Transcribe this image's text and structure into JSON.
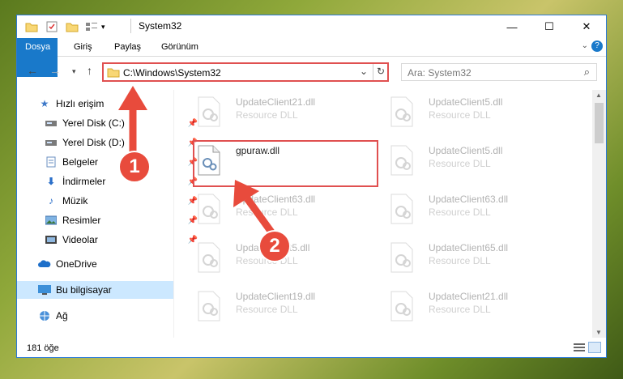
{
  "window": {
    "title": "System32"
  },
  "ribbon": {
    "tabs": [
      "Dosya",
      "Giriş",
      "Paylaş",
      "Görünüm"
    ]
  },
  "address": {
    "path": "C:\\Windows\\System32"
  },
  "search": {
    "placeholder": "Ara: System32"
  },
  "nav": {
    "items": [
      {
        "label": "Hızlı erişim",
        "icon": "star-icon"
      },
      {
        "label": "Yerel Disk (C:)",
        "icon": "drive-icon",
        "pinned": true
      },
      {
        "label": "Yerel Disk (D:)",
        "icon": "drive-icon",
        "pinned": true
      },
      {
        "label": "Belgeler",
        "icon": "documents-icon",
        "pinned": true
      },
      {
        "label": "İndirmeler",
        "icon": "download-icon",
        "pinned": true
      },
      {
        "label": "Müzik",
        "icon": "music-icon",
        "pinned": true
      },
      {
        "label": "Resimler",
        "icon": "pictures-icon",
        "pinned": true
      },
      {
        "label": "Videolar",
        "icon": "videos-icon",
        "pinned": true
      },
      {
        "label": "OneDrive",
        "icon": "cloud-icon"
      },
      {
        "label": "Bu bilgisayar",
        "icon": "computer-icon",
        "selected": true
      },
      {
        "label": "Ağ",
        "icon": "network-icon"
      }
    ]
  },
  "files": [
    {
      "name": "UpdateClient21.dll",
      "type": "Resource DLL",
      "faded": true
    },
    {
      "name": "UpdateClient5.dll",
      "type": "Resource DLL",
      "faded": true
    },
    {
      "name": "gpuraw.dll",
      "type": "",
      "faded": false
    },
    {
      "name": "UpdateClient5.dll",
      "type": "Resource DLL",
      "faded": true
    },
    {
      "name": "UpdateClient63.dll",
      "type": "Resource DLL",
      "faded": true
    },
    {
      "name": "UpdateClient63.dll",
      "type": "Resource DLL",
      "faded": true
    },
    {
      "name": "UpdateClient5.dll",
      "type": "Resource DLL",
      "faded": true
    },
    {
      "name": "UpdateClient65.dll",
      "type": "Resource DLL",
      "faded": true
    },
    {
      "name": "UpdateClient19.dll",
      "type": "Resource DLL",
      "faded": true
    },
    {
      "name": "UpdateClient21.dll",
      "type": "Resource DLL",
      "faded": true
    }
  ],
  "status": {
    "count": "181 öğe"
  },
  "annotations": {
    "badge1": "1",
    "badge2": "2",
    "color": "#e84b3c"
  }
}
